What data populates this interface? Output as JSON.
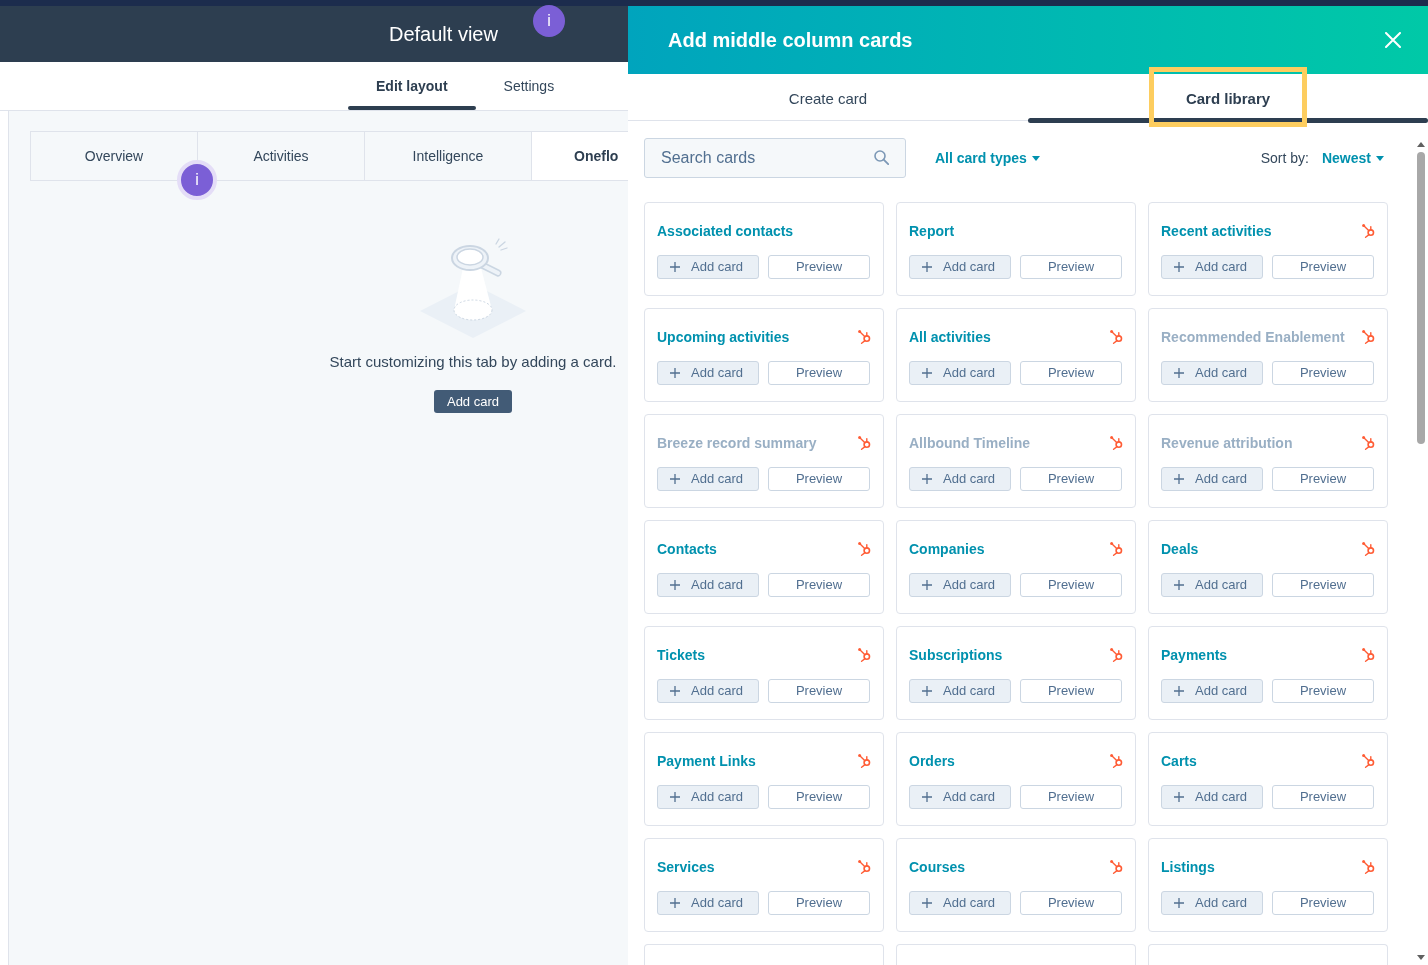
{
  "editor": {
    "title": "Default view",
    "badge": "i",
    "tabs": [
      {
        "label": "Edit layout",
        "selected": true
      },
      {
        "label": "Settings",
        "selected": false
      }
    ],
    "record_tabs": [
      {
        "label": "Overview",
        "selected": false
      },
      {
        "label": "Activities",
        "selected": false
      },
      {
        "label": "Intelligence",
        "selected": false
      },
      {
        "label": "Oneflo",
        "selected": true
      }
    ],
    "tab_badge": "i",
    "empty_state": {
      "message": "Start customizing this tab by adding a card.",
      "button": "Add card"
    }
  },
  "panel": {
    "title": "Add middle column cards",
    "tabs": [
      {
        "label": "Create card",
        "selected": false,
        "highlighted": false
      },
      {
        "label": "Card library",
        "selected": true,
        "highlighted": true
      }
    ],
    "search": {
      "placeholder": "Search cards"
    },
    "filter": "All card types",
    "sort_label": "Sort by:",
    "sort_value": "Newest",
    "cards": [
      {
        "kind": "card",
        "title": "Associated contacts",
        "disabled": false,
        "sprocket": false,
        "add_button": "Add card",
        "preview_button": "Preview"
      },
      {
        "kind": "card",
        "title": "Report",
        "disabled": false,
        "sprocket": false,
        "add_button": "Add card",
        "preview_button": "Preview"
      },
      {
        "kind": "card",
        "title": "Recent activities",
        "disabled": false,
        "sprocket": true,
        "add_button": "Add card",
        "preview_button": "Preview"
      },
      {
        "kind": "card",
        "title": "Upcoming activities",
        "disabled": false,
        "sprocket": true,
        "add_button": "Add card",
        "preview_button": "Preview"
      },
      {
        "kind": "card",
        "title": "All activities",
        "disabled": false,
        "sprocket": true,
        "add_button": "Add card",
        "preview_button": "Preview"
      },
      {
        "kind": "card",
        "title": "Recommended Enablement",
        "disabled": true,
        "sprocket": true,
        "add_button": "Add card",
        "preview_button": "Preview"
      },
      {
        "kind": "card",
        "title": "Breeze record summary",
        "disabled": true,
        "sprocket": true,
        "add_button": "Add card",
        "preview_button": "Preview"
      },
      {
        "kind": "card",
        "title": "Allbound Timeline",
        "disabled": true,
        "sprocket": true,
        "add_button": "Add card",
        "preview_button": "Preview"
      },
      {
        "kind": "card",
        "title": "Revenue attribution",
        "disabled": true,
        "sprocket": true,
        "add_button": "Add card",
        "preview_button": "Preview"
      },
      {
        "kind": "card",
        "title": "Contacts",
        "disabled": false,
        "sprocket": true,
        "add_button": "Add card",
        "preview_button": "Preview"
      },
      {
        "kind": "card",
        "title": "Companies",
        "disabled": false,
        "sprocket": true,
        "add_button": "Add card",
        "preview_button": "Preview"
      },
      {
        "kind": "card",
        "title": "Deals",
        "disabled": false,
        "sprocket": true,
        "add_button": "Add card",
        "preview_button": "Preview"
      },
      {
        "kind": "card",
        "title": "Tickets",
        "disabled": false,
        "sprocket": true,
        "add_button": "Add card",
        "preview_button": "Preview"
      },
      {
        "kind": "card",
        "title": "Subscriptions",
        "disabled": false,
        "sprocket": true,
        "add_button": "Add card",
        "preview_button": "Preview"
      },
      {
        "kind": "card",
        "title": "Payments",
        "disabled": false,
        "sprocket": true,
        "add_button": "Add card",
        "preview_button": "Preview"
      },
      {
        "kind": "card",
        "title": "Payment Links",
        "disabled": false,
        "sprocket": true,
        "add_button": "Add card",
        "preview_button": "Preview"
      },
      {
        "kind": "card",
        "title": "Orders",
        "disabled": false,
        "sprocket": true,
        "add_button": "Add card",
        "preview_button": "Preview"
      },
      {
        "kind": "card",
        "title": "Carts",
        "disabled": false,
        "sprocket": true,
        "add_button": "Add card",
        "preview_button": "Preview"
      },
      {
        "kind": "card",
        "title": "Services",
        "disabled": false,
        "sprocket": true,
        "add_button": "Add card",
        "preview_button": "Preview"
      },
      {
        "kind": "card",
        "title": "Courses",
        "disabled": false,
        "sprocket": true,
        "add_button": "Add card",
        "preview_button": "Preview"
      },
      {
        "kind": "card",
        "title": "Listings",
        "disabled": false,
        "sprocket": true,
        "add_button": "Add card",
        "preview_button": "Preview"
      },
      {
        "kind": "partial"
      },
      {
        "kind": "partial"
      },
      {
        "kind": "partial"
      }
    ]
  }
}
